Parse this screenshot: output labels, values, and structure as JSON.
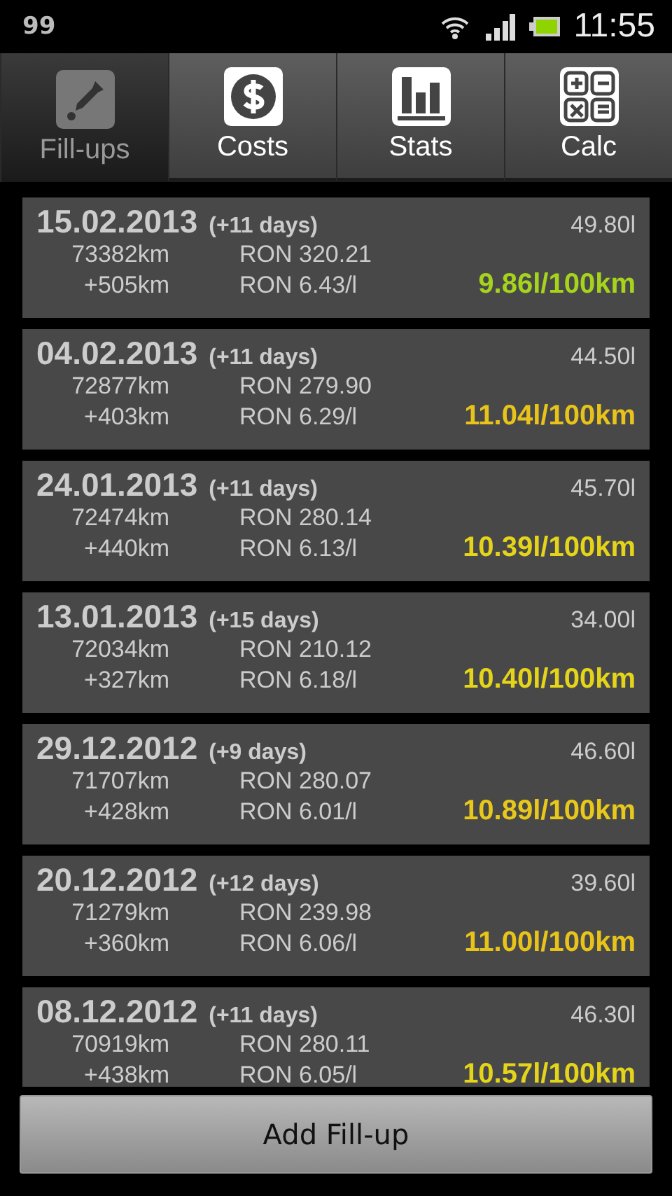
{
  "status_bar": {
    "notification": "99",
    "time": "11:55"
  },
  "tabs": [
    {
      "label": "Fill-ups",
      "kind": "dropper",
      "selected": true
    },
    {
      "label": "Costs",
      "kind": "dollar",
      "selected": false
    },
    {
      "label": "Stats",
      "kind": "chart",
      "selected": false
    },
    {
      "label": "Calc",
      "kind": "calc",
      "selected": false
    }
  ],
  "fillups": [
    {
      "date": "15.02.2013",
      "interval": "(+11 days)",
      "volume": "49.80l",
      "odometer": "73382km",
      "cost": "RON 320.21",
      "distance": "+505km",
      "price": "RON 6.43/l",
      "consumption": "9.86l/100km",
      "color": "#a6d41c"
    },
    {
      "date": "04.02.2013",
      "interval": "(+11 days)",
      "volume": "44.50l",
      "odometer": "72877km",
      "cost": "RON 279.90",
      "distance": "+403km",
      "price": "RON 6.29/l",
      "consumption": "11.04l/100km",
      "color": "#e8c41a"
    },
    {
      "date": "24.01.2013",
      "interval": "(+11 days)",
      "volume": "45.70l",
      "odometer": "72474km",
      "cost": "RON 280.14",
      "distance": "+440km",
      "price": "RON 6.13/l",
      "consumption": "10.39l/100km",
      "color": "#e4d41a"
    },
    {
      "date": "13.01.2013",
      "interval": "(+15 days)",
      "volume": "34.00l",
      "odometer": "72034km",
      "cost": "RON 210.12",
      "distance": "+327km",
      "price": "RON 6.18/l",
      "consumption": "10.40l/100km",
      "color": "#e4d41a"
    },
    {
      "date": "29.12.2012",
      "interval": "(+9 days)",
      "volume": "46.60l",
      "odometer": "71707km",
      "cost": "RON 280.07",
      "distance": "+428km",
      "price": "RON 6.01/l",
      "consumption": "10.89l/100km",
      "color": "#e8c81a"
    },
    {
      "date": "20.12.2012",
      "interval": "(+12 days)",
      "volume": "39.60l",
      "odometer": "71279km",
      "cost": "RON 239.98",
      "distance": "+360km",
      "price": "RON 6.06/l",
      "consumption": "11.00l/100km",
      "color": "#e8c41a"
    },
    {
      "date": "08.12.2012",
      "interval": "(+11 days)",
      "volume": "46.30l",
      "odometer": "70919km",
      "cost": "RON 280.11",
      "distance": "+438km",
      "price": "RON 6.05/l",
      "consumption": "10.57l/100km",
      "color": "#e4d41a"
    }
  ],
  "add_button": "Add Fill-up"
}
